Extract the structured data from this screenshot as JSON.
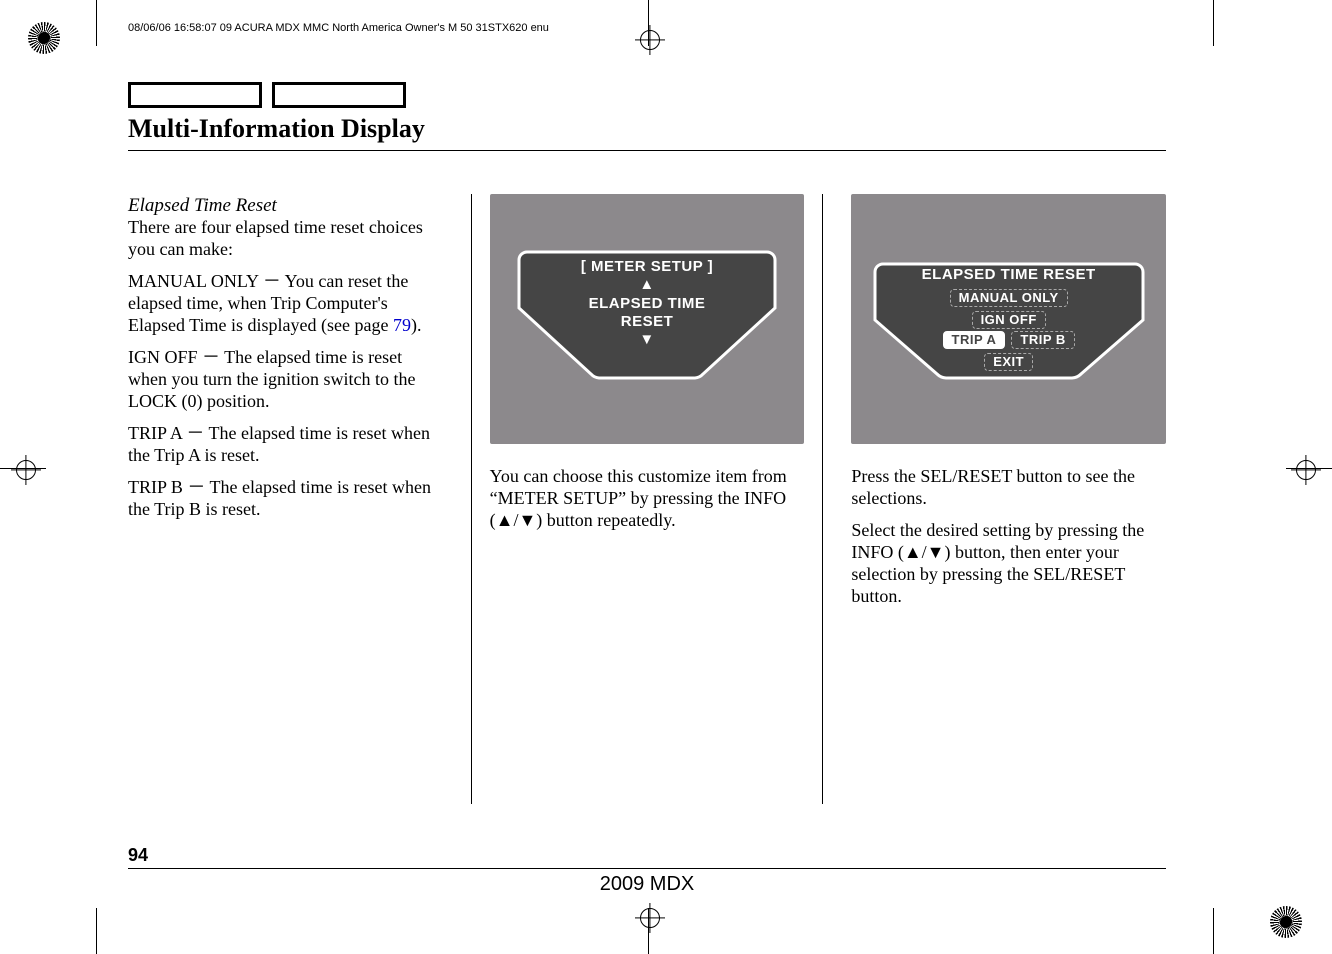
{
  "header_meta": "08/06/06 16:58:07    09 ACURA MDX MMC North America Owner's M 50 31STX620 enu",
  "page_title": "Multi-Information Display",
  "col1": {
    "subhead": "Elapsed Time Reset",
    "intro": "There are four elapsed time reset choices you can make:",
    "manual_only": "MANUAL ONLY － You can reset the elapsed time, when Trip Computer's Elapsed Time is displayed (see page ",
    "page_ref": "79",
    "manual_only_end": ").",
    "ign_off": "IGN OFF － The elapsed time is reset when you turn the ignition switch to the LOCK (0) position.",
    "trip_a": "TRIP A － The elapsed time is reset when the Trip A is reset.",
    "trip_b": "TRIP B － The elapsed time is reset when the Trip B is reset."
  },
  "col2": {
    "screen": {
      "line1": "[ METER SETUP ]",
      "line2": "ELAPSED TIME",
      "line3": "RESET"
    },
    "caption": "You can choose this customize item from “METER SETUP” by pressing the INFO (▲/▼) button repeatedly."
  },
  "col3": {
    "screen": {
      "title": "ELAPSED TIME RESET",
      "opt_manual": "MANUAL ONLY",
      "opt_ign": "IGN OFF",
      "opt_trip_a": "TRIP A",
      "opt_trip_b": "TRIP B",
      "opt_exit": "EXIT"
    },
    "caption1": "Press the SEL/RESET button to see the selections.",
    "caption2": "Select the desired setting by pressing the INFO (▲/▼) button, then enter your selection by pressing the SEL/RESET button."
  },
  "footer": {
    "page_number": "94",
    "model_year": "2009  MDX"
  }
}
